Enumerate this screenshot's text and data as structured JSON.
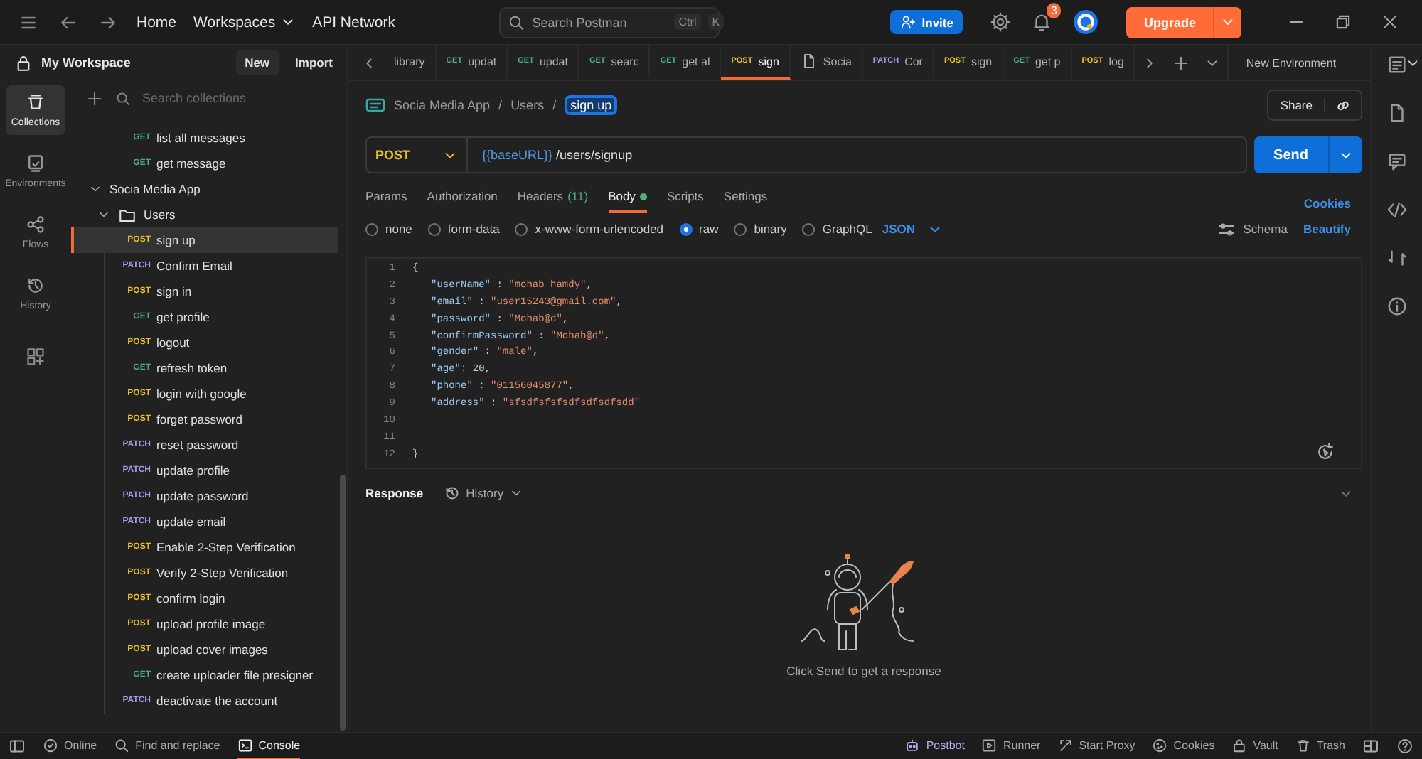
{
  "top_bar": {
    "nav": [
      {
        "label": "Home",
        "dropdown": false
      },
      {
        "label": "Workspaces",
        "dropdown": true
      },
      {
        "label": "API Network",
        "dropdown": false
      }
    ],
    "search": {
      "placeholder": "Search Postman",
      "shortcut": [
        "Ctrl",
        "K"
      ]
    },
    "invite": "Invite",
    "notifications": "3",
    "upgrade": "Upgrade"
  },
  "sidebar": {
    "workspace": "My Workspace",
    "buttons": [
      "New",
      "Import"
    ],
    "search": {
      "placeholder": "Search collections"
    },
    "rail": [
      {
        "kind": "collections",
        "label": "Collections",
        "selected": true
      },
      {
        "kind": "environments",
        "label": "Environments",
        "selected": false
      },
      {
        "kind": "flows",
        "label": "Flows",
        "selected": false
      },
      {
        "kind": "history",
        "label": "History",
        "selected": false
      }
    ],
    "tree": [
      {
        "kind": "request",
        "method": "GET",
        "color": "#4caf7d",
        "name": "list all messages",
        "selected": false
      },
      {
        "kind": "request",
        "method": "GET",
        "color": "#4caf7d",
        "name": "get message",
        "selected": false
      },
      {
        "kind": "collection",
        "name": "Socia Media App",
        "expanded": true,
        "children": [
          {
            "kind": "folder",
            "name": "Users",
            "expanded": true,
            "children": [
              {
                "kind": "request",
                "method": "POST",
                "color": "#e6c229",
                "name": "sign up",
                "selected": true
              },
              {
                "kind": "request",
                "method": "PATCH",
                "color": "#a69ae6",
                "name": "Confirm Email",
                "selected": false
              },
              {
                "kind": "request",
                "method": "POST",
                "color": "#e6c229",
                "name": "sign in",
                "selected": false
              },
              {
                "kind": "request",
                "method": "GET",
                "color": "#4caf7d",
                "name": "get profile",
                "selected": false
              },
              {
                "kind": "request",
                "method": "POST",
                "color": "#e6c229",
                "name": "logout",
                "selected": false
              },
              {
                "kind": "request",
                "method": "GET",
                "color": "#4caf7d",
                "name": "refresh token",
                "selected": false
              },
              {
                "kind": "request",
                "method": "POST",
                "color": "#e6c229",
                "name": "login with google",
                "selected": false
              },
              {
                "kind": "request",
                "method": "POST",
                "color": "#e6c229",
                "name": "forget password",
                "selected": false
              },
              {
                "kind": "request",
                "method": "PATCH",
                "color": "#a69ae6",
                "name": "reset password",
                "selected": false
              },
              {
                "kind": "request",
                "method": "PATCH",
                "color": "#a69ae6",
                "name": "update profile",
                "selected": false
              },
              {
                "kind": "request",
                "method": "PATCH",
                "color": "#a69ae6",
                "name": "update password",
                "selected": false
              },
              {
                "kind": "request",
                "method": "PATCH",
                "color": "#a69ae6",
                "name": "update email",
                "selected": false
              },
              {
                "kind": "request",
                "method": "POST",
                "color": "#e6c229",
                "name": "Enable 2-Step Verification",
                "selected": false
              },
              {
                "kind": "request",
                "method": "POST",
                "color": "#e6c229",
                "name": "Verify 2-Step Verification",
                "selected": false
              },
              {
                "kind": "request",
                "method": "POST",
                "color": "#e6c229",
                "name": "confirm login",
                "selected": false
              },
              {
                "kind": "request",
                "method": "POST",
                "color": "#e6c229",
                "name": "upload profile image",
                "selected": false
              },
              {
                "kind": "request",
                "method": "POST",
                "color": "#e6c229",
                "name": "upload cover images",
                "selected": false
              },
              {
                "kind": "request",
                "method": "GET",
                "color": "#4caf7d",
                "name": "create uploader file presigner",
                "selected": false
              },
              {
                "kind": "request",
                "method": "PATCH",
                "color": "#a69ae6",
                "name": "deactivate the account",
                "selected": false
              }
            ]
          }
        ]
      }
    ]
  },
  "tabs": [
    {
      "kind": "plain",
      "name": "library",
      "selected": false
    },
    {
      "kind": "request",
      "method": "GET",
      "color": "#4caf7d",
      "name": "updat",
      "selected": false
    },
    {
      "kind": "request",
      "method": "GET",
      "color": "#4caf7d",
      "name": "updat",
      "selected": false
    },
    {
      "kind": "request",
      "method": "GET",
      "color": "#4caf7d",
      "name": "searc",
      "selected": false
    },
    {
      "kind": "request",
      "method": "GET",
      "color": "#4caf7d",
      "name": "get al",
      "selected": false
    },
    {
      "kind": "request",
      "method": "POST",
      "color": "#e6c229",
      "name": "sign",
      "selected": true
    },
    {
      "kind": "collection",
      "name": "Socia",
      "selected": false
    },
    {
      "kind": "request",
      "method": "PATCH",
      "color": "#a69ae6",
      "name": "Cor",
      "selected": false
    },
    {
      "kind": "request",
      "method": "POST",
      "color": "#e6c229",
      "name": "sign",
      "selected": false
    },
    {
      "kind": "request",
      "method": "GET",
      "color": "#4caf7d",
      "name": "get p",
      "selected": false
    },
    {
      "kind": "request",
      "method": "POST",
      "color": "#e6c229",
      "name": "log",
      "selected": false
    }
  ],
  "environment": "New Environment",
  "request": {
    "breadcrumb": [
      {
        "label": "Socia Media App",
        "separator": "/"
      },
      {
        "label": "Users",
        "separator": "/"
      }
    ],
    "name": "sign up",
    "share": "Share",
    "method": "POST",
    "url_variable": "{{baseURL}}",
    "url_path": " /users/signup",
    "send": "Send",
    "tabs": [
      {
        "label": "Params",
        "modified": false,
        "selected": false
      },
      {
        "label": "Authorization",
        "modified": false,
        "selected": false
      },
      {
        "label": "Headers",
        "count": "(11)",
        "modified": false,
        "selected": false
      },
      {
        "label": "Body",
        "modified": true,
        "selected": true
      },
      {
        "label": "Scripts",
        "modified": false,
        "selected": false
      },
      {
        "label": "Settings",
        "modified": false,
        "selected": false
      }
    ],
    "cookies": "Cookies",
    "body_types": [
      {
        "label": "none",
        "selected": false
      },
      {
        "label": "form-data",
        "selected": false
      },
      {
        "label": "x-www-form-urlencoded",
        "selected": false
      },
      {
        "label": "raw",
        "selected": true
      },
      {
        "label": "binary",
        "selected": false
      },
      {
        "label": "GraphQL",
        "selected": false
      }
    ],
    "format": "JSON",
    "schema": "Schema",
    "beautify": "Beautify",
    "code_lines": [
      {
        "number": "1",
        "indented": false,
        "tokens": [
          {
            "kind": "punct",
            "text": "{"
          }
        ]
      },
      {
        "number": "2",
        "indented": true,
        "tokens": [
          {
            "kind": "key",
            "text": "\"userName\""
          },
          {
            "kind": "punct",
            "text": " : "
          },
          {
            "kind": "string",
            "text": "\"mohab hamdy\""
          },
          {
            "kind": "punct",
            "text": ","
          }
        ]
      },
      {
        "number": "3",
        "indented": true,
        "tokens": [
          {
            "kind": "key",
            "text": "\"email\""
          },
          {
            "kind": "punct",
            "text": " : "
          },
          {
            "kind": "string",
            "text": "\"user15243@gmail.com\""
          },
          {
            "kind": "punct",
            "text": ","
          }
        ]
      },
      {
        "number": "4",
        "indented": true,
        "tokens": [
          {
            "kind": "key",
            "text": "\"password\""
          },
          {
            "kind": "punct",
            "text": " : "
          },
          {
            "kind": "string",
            "text": "\"Mohab@d\""
          },
          {
            "kind": "punct",
            "text": ","
          }
        ]
      },
      {
        "number": "5",
        "indented": true,
        "tokens": [
          {
            "kind": "key",
            "text": "\"confirmPassword\""
          },
          {
            "kind": "punct",
            "text": " : "
          },
          {
            "kind": "string",
            "text": "\"Mohab@d\""
          },
          {
            "kind": "punct",
            "text": ","
          }
        ]
      },
      {
        "number": "6",
        "indented": true,
        "tokens": [
          {
            "kind": "key",
            "text": "\"gender\""
          },
          {
            "kind": "punct",
            "text": " : "
          },
          {
            "kind": "string",
            "text": "\"male\""
          },
          {
            "kind": "punct",
            "text": ","
          }
        ]
      },
      {
        "number": "7",
        "indented": true,
        "tokens": [
          {
            "kind": "key",
            "text": "\"age\""
          },
          {
            "kind": "punct",
            "text": ": 20,"
          }
        ]
      },
      {
        "number": "8",
        "indented": true,
        "tokens": [
          {
            "kind": "key",
            "text": "\"phone\""
          },
          {
            "kind": "punct",
            "text": " : "
          },
          {
            "kind": "string",
            "text": "\"01156045877\""
          },
          {
            "kind": "punct",
            "text": ","
          }
        ]
      },
      {
        "number": "9",
        "indented": true,
        "tokens": [
          {
            "kind": "key",
            "text": "\"address\""
          },
          {
            "kind": "punct",
            "text": " : "
          },
          {
            "kind": "string",
            "text": "\"sfsdfsfsfsdfsdfsdfsdd\""
          }
        ]
      },
      {
        "number": "10"
      },
      {
        "number": "11"
      },
      {
        "number": "12",
        "indented": false,
        "tokens": [
          {
            "kind": "punct",
            "text": "}"
          }
        ]
      }
    ]
  },
  "response": {
    "title": "Response",
    "history": "History",
    "empty_message": "Click Send to get a response"
  },
  "status_bar": {
    "left": [
      {
        "kind": "online",
        "label": "Online",
        "selected": false
      },
      {
        "kind": "find",
        "label": "Find and replace",
        "selected": false
      },
      {
        "kind": "console",
        "label": "Console",
        "selected": true
      }
    ],
    "right": [
      {
        "kind": "postbot",
        "label": "Postbot"
      },
      {
        "kind": "runner",
        "label": "Runner"
      },
      {
        "kind": "proxy",
        "label": "Start Proxy"
      },
      {
        "kind": "cookies",
        "label": "Cookies"
      },
      {
        "kind": "vault",
        "label": "Vault"
      },
      {
        "kind": "trash",
        "label": "Trash"
      }
    ]
  }
}
